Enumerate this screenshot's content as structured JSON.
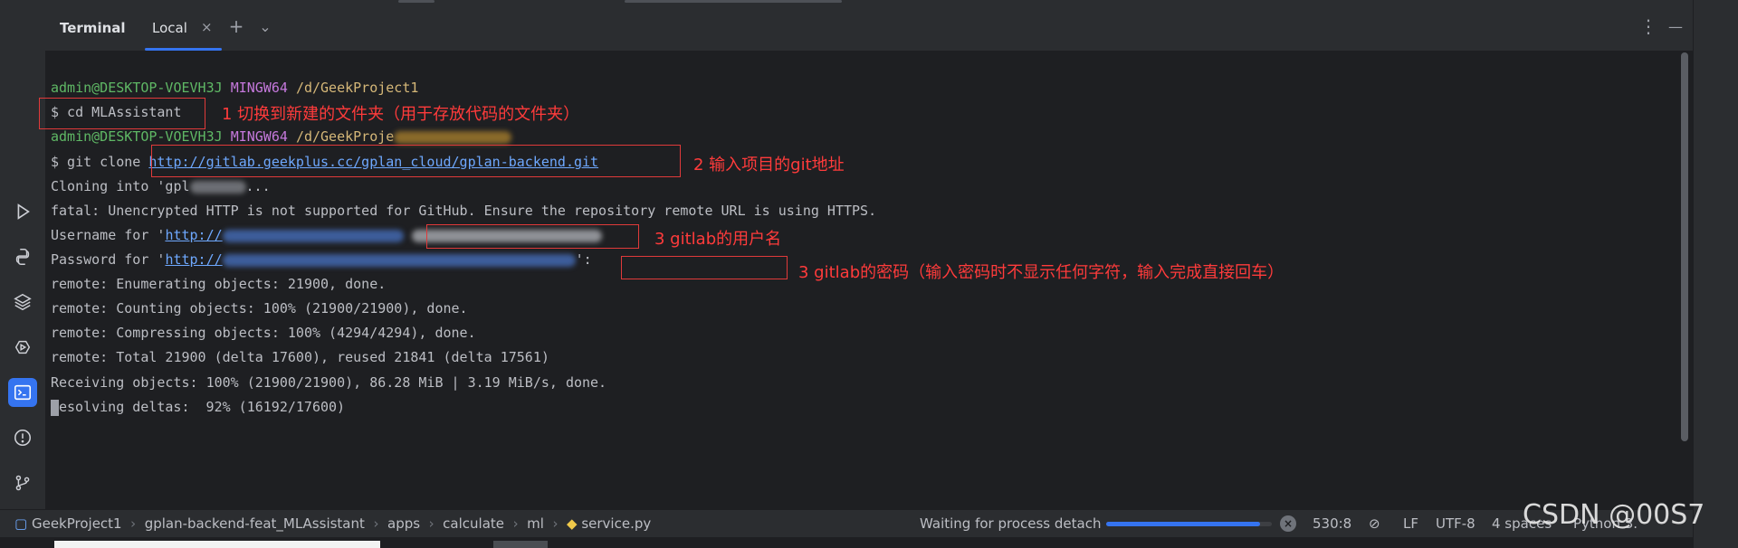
{
  "terminal": {
    "title": "Terminal",
    "tab": {
      "label": "Local",
      "close": "×"
    },
    "add": "+",
    "dropdown": "⌄",
    "more": "⋮",
    "minimize": "—",
    "lines": {
      "prompt1_user": "admin@DESKTOP-VOEVH3J",
      "prompt1_env": "MINGW64",
      "prompt1_path": "/d/GeekProject1",
      "cmd1": "$ cd MLAssistant",
      "prompt2_user": "admin@DESKTOP-VOEVH3J",
      "prompt2_env": "MINGW64",
      "prompt2_path": "/d/GeekProje",
      "cmd2_prefix": "$ git clone ",
      "cmd2_url": "http://gitlab.geekplus.cc/gplan_cloud/gplan-backend.git",
      "cloning_prefix": "Cloning into 'gpl",
      "cloning_suffix": "...",
      "fatal": "fatal: Unencrypted HTTP is not supported for GitHub. Ensure the repository remote URL is using HTTPS.",
      "username_prefix": "Username for '",
      "username_url": "http://",
      "password_prefix": "Password for '",
      "password_url": "http://",
      "password_suffix": "':",
      "enumerating": "remote: Enumerating objects: 21900, done.",
      "counting": "remote: Counting objects: 100% (21900/21900), done.",
      "compressing": "remote: Compressing objects: 100% (4294/4294), done.",
      "total": "remote: Total 21900 (delta 17600), reused 21841 (delta 17561)",
      "receiving": "Receiving objects: 100% (21900/21900), 86.28 MiB | 3.19 MiB/s, done.",
      "resolving": "esolving deltas:  92% (16192/17600)"
    },
    "annotations": {
      "a1": "1 切换到新建的文件夹（用于存放代码的文件夹）",
      "a2": "2 输入项目的git地址",
      "a3": "3 gitlab的用户名",
      "a4": "3 gitlab的密码（输入密码时不显示任何字符，输入完成直接回车）"
    }
  },
  "statusbar": {
    "breadcrumbs": [
      "GeekProject1",
      "gplan-backend-feat_MLAssistant",
      "apps",
      "calculate",
      "ml",
      "service.py"
    ],
    "process_text": "Waiting for process detach",
    "progress": 0.93,
    "position": "530:8",
    "line_ending": "LF",
    "encoding": "UTF-8",
    "indent": "4 spaces",
    "interpreter": "Python 3."
  },
  "watermark": "CSDN @00S7",
  "colors": {
    "accent": "#3574f0",
    "annotation": "#ff3b3b",
    "prompt_user": "#5fb865",
    "prompt_env": "#c679dd",
    "prompt_path": "#d5b778"
  }
}
